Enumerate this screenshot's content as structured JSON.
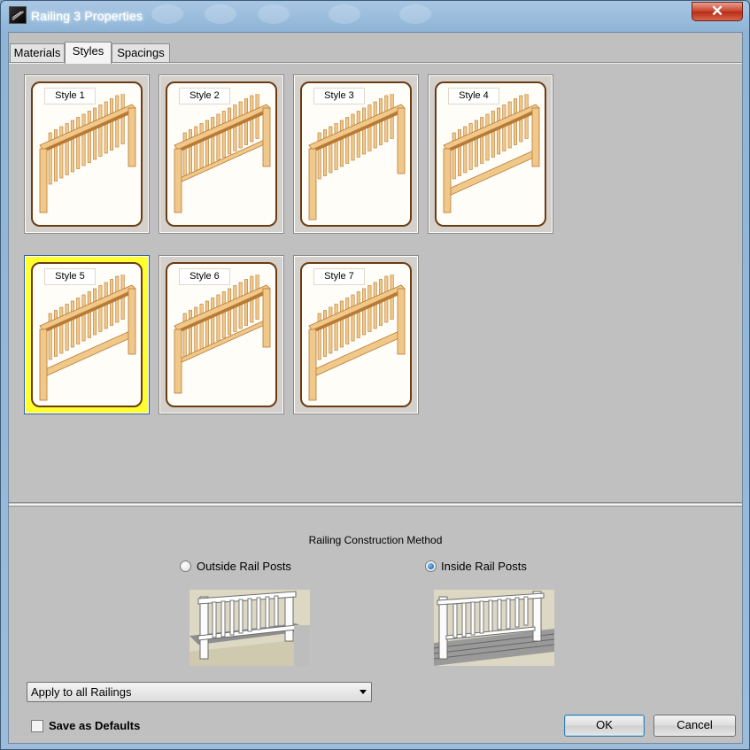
{
  "window": {
    "title": "Railing 3 Properties",
    "close_glyph": "✕"
  },
  "tabs": [
    {
      "label": "Materials",
      "active": false
    },
    {
      "label": "Styles",
      "active": true
    },
    {
      "label": "Spacings",
      "active": false
    }
  ],
  "styles": {
    "selected": "Style 5",
    "items": [
      {
        "label": "Style 1"
      },
      {
        "label": "Style 2"
      },
      {
        "label": "Style 3"
      },
      {
        "label": "Style 4"
      },
      {
        "label": "Style 5"
      },
      {
        "label": "Style 6"
      },
      {
        "label": "Style 7"
      }
    ]
  },
  "construction": {
    "title": "Railing Construction Method",
    "options": [
      {
        "label": "Outside Rail Posts",
        "checked": false,
        "icon": "outside-rail-posts-preview"
      },
      {
        "label": "Inside Rail Posts",
        "checked": true,
        "icon": "inside-rail-posts-preview"
      }
    ]
  },
  "apply_dropdown": {
    "value": "Apply to all Railings"
  },
  "save_defaults": {
    "label": "Save as Defaults",
    "checked": false
  },
  "buttons": {
    "ok": "OK",
    "cancel": "Cancel"
  },
  "colors": {
    "selected_tile": "#ffff2e",
    "wood_light": "#f0c88a",
    "wood_dark": "#b87a34",
    "card_border": "#6b3c12"
  }
}
